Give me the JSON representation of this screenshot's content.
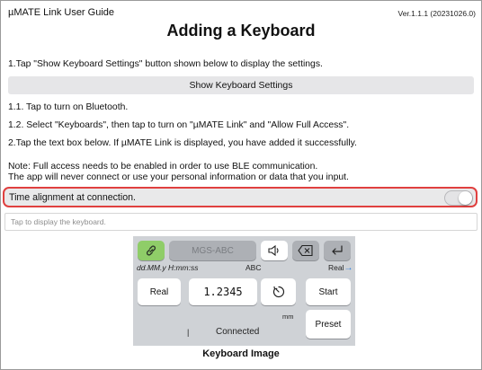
{
  "header": {
    "title": "µMATE Link User  Guide",
    "version": "Ver.1.1.1 (20231026.0)",
    "heading": "Adding a Keyboard"
  },
  "instructions": {
    "step1": "1.Tap \"Show Keyboard Settings\" button shown below to display the settings.",
    "show_button": "Show Keyboard Settings",
    "step1_1": "1.1. Tap to turn on Bluetooth.",
    "step1_2": "1.2. Select \"Keyboards\", then tap to turn on \"µMATE Link\" and \"Allow Full Access\".",
    "step2": "2.Tap the text box below. If µMATE Link is displayed, you have added it successfully.",
    "note1": "Note: Full access needs to be enabled in order to use BLE communication.",
    "note2": "The app will never connect or use your personal information or data that you  input."
  },
  "settings": {
    "time_alignment_label": "Time alignment at connection.",
    "time_alignment_on": false
  },
  "textbox": {
    "placeholder": "Tap to display the keyboard."
  },
  "keyboard": {
    "device_name": "MGS-ABC",
    "format": "dd.MM.y H:mm:ss",
    "mode": "ABC",
    "type_label": "Real",
    "real_key": "Real",
    "value": "1.2345",
    "unit": "mm",
    "start_key": "Start",
    "preset_key": "Preset",
    "status": "Connected",
    "cursor": "|"
  },
  "caption": "Keyboard Image",
  "colors": {
    "highlight_border": "#e0403f",
    "button_bg": "#e6e6e8",
    "link_key": "#8fcd68",
    "arrow": "#2a7de1"
  },
  "icons": [
    "link-icon",
    "speaker-icon",
    "backspace-icon",
    "return-icon",
    "timer-icon",
    "arrow-right-icon"
  ]
}
